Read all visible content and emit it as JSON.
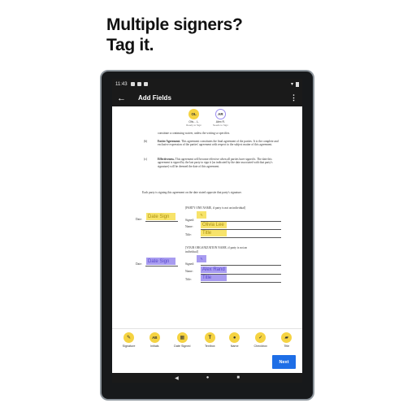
{
  "headline": {
    "line1": "Multiple signers?",
    "line2": "Tag it."
  },
  "status": {
    "time": "11:43"
  },
  "appbar": {
    "back": "←",
    "title": "Add Fields",
    "more": "⋮"
  },
  "signers": [
    {
      "initials": "OL",
      "name": "Oliv... L.",
      "status": "Ready to Sign",
      "color": "#f5d342"
    },
    {
      "initials": "AR",
      "name": "Alex R.",
      "status": "Needs to Sign",
      "color": "#ffffff"
    }
  ],
  "document": {
    "top_line": "constitute a continuing waiver, unless the writing so specifies.",
    "para_b": {
      "num": "(b)",
      "head": "Entire Agreement.",
      "text": "This agreement constitutes the final agreement of the parties. It is the complete and exclusive expression of the parties' agreement with respect to the subject matter of this agreement."
    },
    "para_c": {
      "num": "(c)",
      "head": "Effectiveness.",
      "text": "This agreement will become effective when all parties have signed it. The date this agreement is signed by the last party to sign it (as indicated by the date associated with that party's signature) will be deemed the date of this agreement."
    },
    "intro": "Each party is signing this agreement on the date stated opposite that party's signature.",
    "party1": {
      "header": "[PARTY ONE NAME, if party is not an individual]",
      "date_label": "Date:",
      "signed_label": "Signed:",
      "name_label": "Name:",
      "title_label": "Title:"
    },
    "party2": {
      "header1": "[YOUR ORGANIZATION NAME, if party is not an",
      "header2": "individual]",
      "date_label": "Date:",
      "signed_label": "Signed:",
      "name_label": "Name:",
      "title_label": "Title:"
    },
    "fields": {
      "date_sign": "Date Sign",
      "name1": "Olivia Lee",
      "title": "Title",
      "name2": "Alex Rand",
      "sign_mark": "✎"
    }
  },
  "toolbar": [
    {
      "label": "Signature",
      "icon": "✎",
      "icon_name": "signature-icon"
    },
    {
      "label": "Initials",
      "icon": "AB",
      "icon_name": "initials-icon"
    },
    {
      "label": "Date Signed",
      "icon": "▦",
      "icon_name": "calendar-icon"
    },
    {
      "label": "Textbox",
      "icon": "T",
      "icon_name": "textbox-icon"
    },
    {
      "label": "Name",
      "icon": "●",
      "icon_name": "person-icon"
    },
    {
      "label": "Checkbox",
      "icon": "✓",
      "icon_name": "checkbox-icon"
    },
    {
      "label": "Title",
      "icon": "▰",
      "icon_name": "briefcase-icon"
    }
  ],
  "next_label": "Next",
  "nav": {
    "back": "◀",
    "home": "●",
    "recents": "■"
  }
}
